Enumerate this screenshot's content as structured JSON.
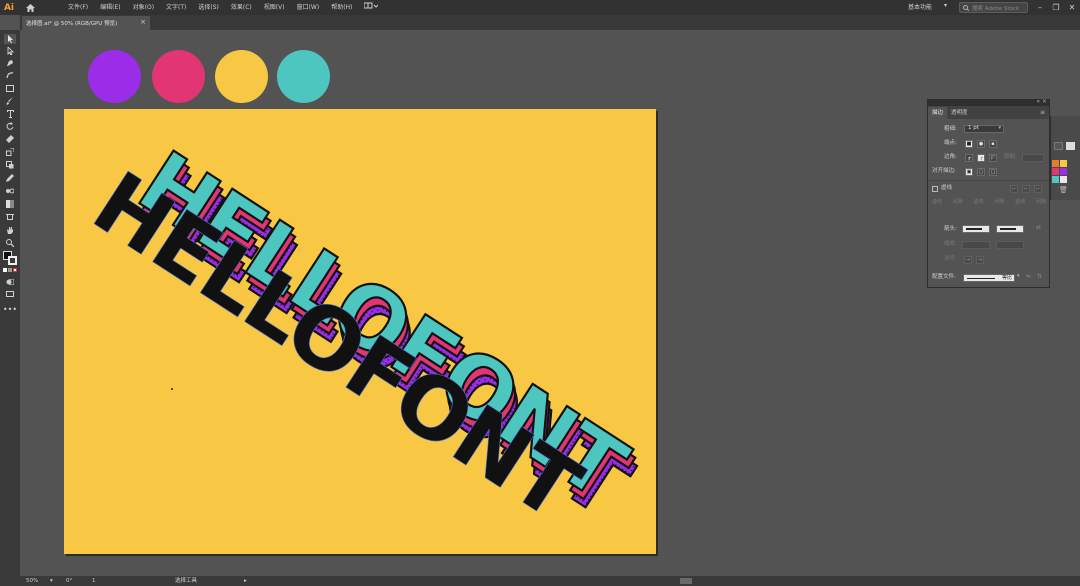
{
  "app": {
    "logo": "Ai",
    "menus": [
      "文件(F)",
      "编辑(E)",
      "对象(O)",
      "文字(T)",
      "选择(S)",
      "效果(C)",
      "视图(V)",
      "窗口(W)",
      "帮助(H)"
    ],
    "workspace": "基本功能",
    "search_placeholder": "搜索 Adobe Stock",
    "document_tab": "选择图.ai* @ 50% (RGB/GPU 预览)"
  },
  "icons": {
    "home": "home-icon",
    "close": "close-icon",
    "minimize": "minimize-icon",
    "maximize": "maximize-icon",
    "search": "search-icon",
    "layout": "layout-icon"
  },
  "swatch_colors": [
    "#9b2de8",
    "#e23574",
    "#f6c844",
    "#4ec6c0"
  ],
  "artboard": {
    "background": "#f8c845",
    "text": "HELLOFONT"
  },
  "stroke_panel": {
    "tabs": [
      "描边",
      "透明度"
    ],
    "weight_label": "粗细:",
    "weight_value": "1 pt",
    "cap_label": "端点:",
    "corner_label": "边角:",
    "limit_label": "限制:",
    "align_label": "对齐描边:",
    "dashed_label": "虚线",
    "dash_fields": [
      "虚线",
      "间隙",
      "虚线",
      "间隙",
      "虚线",
      "间隙"
    ],
    "arrow_label": "箭头:",
    "scale_label": "缩放:",
    "align2_label": "对齐:",
    "profile_label": "配置文件:",
    "profile_value": "等比"
  },
  "status": {
    "zoom": "50%",
    "rotation": "0°",
    "page": "1",
    "tool": "选择工具"
  },
  "tools": [
    "selection-tool-icon",
    "direct-selection-tool-icon",
    "pen-tool-icon",
    "curvature-tool-icon",
    "rectangle-tool-icon",
    "paintbrush-tool-icon",
    "type-tool-icon",
    "rotate-tool-icon",
    "eraser-tool-icon",
    "scale-tool-icon",
    "shape-builder-tool-icon",
    "eyedropper-tool-icon",
    "blend-tool-icon",
    "gradient-tool-icon",
    "artboard-tool-icon",
    "hand-tool-icon",
    "zoom-tool-icon"
  ]
}
